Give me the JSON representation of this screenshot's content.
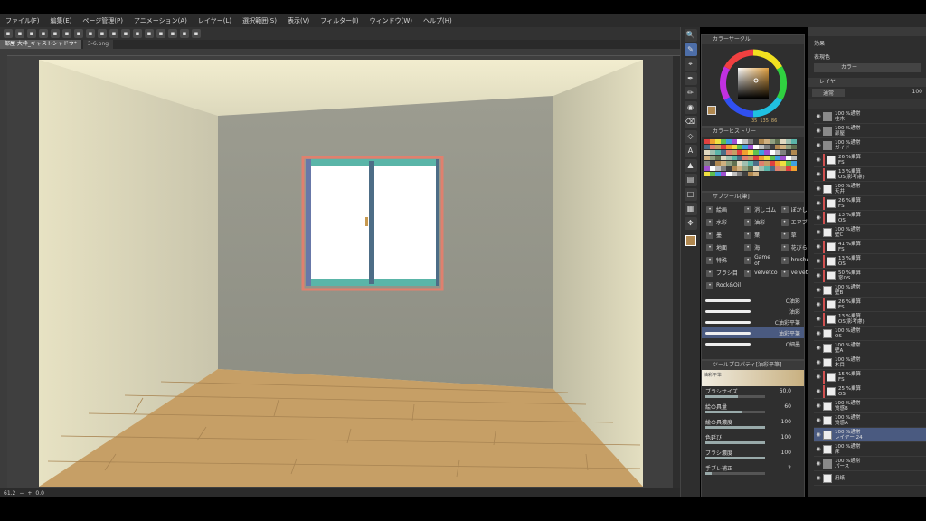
{
  "menu": [
    "ファイル(F)",
    "編集(E)",
    "ページ管理(P)",
    "アニメーション(A)",
    "レイヤー(L)",
    "選択範囲(S)",
    "表示(V)",
    "フィルター(I)",
    "ウィンドウ(W)",
    "ヘルプ(H)"
  ],
  "toolbar_icons": [
    "app-icon",
    "new-icon",
    "open-icon",
    "save-icon",
    "undo-icon",
    "redo-icon",
    "clear-icon",
    "transform-icon",
    "fill-icon",
    "deselect-icon",
    "invert-icon",
    "draw-border-icon",
    "snap-icon",
    "ruler-icon",
    "grid-icon",
    "guide-icon",
    "settings-icon"
  ],
  "doc_tabs": [
    {
      "label": "部屋 大枠_キャストシャドウ*"
    },
    {
      "label": "3-6.png"
    }
  ],
  "status": {
    "zoom": "61.2",
    "angle": "0.0"
  },
  "color": {
    "header": "カラーサークル",
    "main_color": "#b08850",
    "h": "35",
    "s": "135",
    "v": "86"
  },
  "history": {
    "header": "カラーヒストリー"
  },
  "subtool": {
    "header": "サブツール[筆]",
    "groups": [
      {
        "icon": "brush-icon",
        "label": "絵画"
      },
      {
        "icon": "eraser-icon",
        "label": "消しゴム"
      },
      {
        "icon": "blur-icon",
        "label": "ぼかし"
      },
      {
        "icon": "water-icon",
        "label": "水彩"
      },
      {
        "icon": "thick-icon",
        "label": "油彩"
      },
      {
        "icon": "air-icon",
        "label": "エアブラ"
      },
      {
        "icon": "ink-icon",
        "label": "墨"
      },
      {
        "icon": "leaf-icon",
        "label": "葉"
      },
      {
        "icon": "grass-icon",
        "label": "草"
      },
      {
        "icon": "ground-icon",
        "label": "地面"
      },
      {
        "icon": "sea-icon",
        "label": "海"
      },
      {
        "icon": "flower-icon",
        "label": "花びら"
      },
      {
        "icon": "special-icon",
        "label": "特殊"
      },
      {
        "icon": "game-icon",
        "label": "Game of"
      },
      {
        "icon": "brushes-icon",
        "label": "brushes"
      },
      {
        "icon": "brush2-icon",
        "label": "ブラシ目"
      },
      {
        "icon": "velvet-icon",
        "label": "velvetco"
      },
      {
        "icon": "velvet2-icon",
        "label": "velvetco"
      },
      {
        "icon": "rock-icon",
        "label": "Rock&Oil"
      }
    ],
    "brushes": [
      {
        "label": "C油彩"
      },
      {
        "label": "油彩"
      },
      {
        "label": "C油彩平筆"
      },
      {
        "label": "油彩平筆"
      },
      {
        "label": "C細墨"
      }
    ]
  },
  "tool_property": {
    "header": "ツールプロパティ[油彩平筆]",
    "preview_label": "油彩平筆",
    "rows": [
      {
        "label": "ブラシサイズ",
        "value": "60.0",
        "pct": 0.55
      },
      {
        "label": "絵の具量",
        "value": "60",
        "pct": 0.6
      },
      {
        "label": "絵の具濃度",
        "value": "100",
        "pct": 1.0
      },
      {
        "label": "色延び",
        "value": "100",
        "pct": 1.0
      },
      {
        "label": "ブラシ濃度",
        "value": "100",
        "pct": 1.0
      },
      {
        "label": "手ブレ補正",
        "value": "2",
        "pct": 0.1
      }
    ]
  },
  "right_panel": {
    "effect_label": "効果",
    "expression_label": "表現色",
    "expression_value": "カラー",
    "layer_header": "レイヤー",
    "blend_mode": "通常",
    "opacity": "100"
  },
  "layers": [
    {
      "t": "100 %通常\n柱木",
      "sel": false,
      "folder": true
    },
    {
      "t": "100 %通常\n部屋",
      "sel": false,
      "folder": true
    },
    {
      "t": "100 %通常\nガイド",
      "sel": false,
      "folder": true
    },
    {
      "t": "26 %乗算\nFS",
      "sel": false,
      "folder": false
    },
    {
      "t": "13 %乗算\nOS(影考慮)",
      "sel": false,
      "folder": false
    },
    {
      "t": "100 %通常\n天井",
      "sel": false,
      "folder": false
    },
    {
      "t": "26 %乗算\nFS",
      "sel": false,
      "folder": false
    },
    {
      "t": "13 %乗算\nOS",
      "sel": false,
      "folder": false
    },
    {
      "t": "100 %通常\n壁C",
      "sel": false,
      "folder": false
    },
    {
      "t": "41 %乗算\nFS",
      "sel": false,
      "folder": false
    },
    {
      "t": "13 %乗算\nOS",
      "sel": false,
      "folder": false
    },
    {
      "t": "50 %乗算\n窓OS",
      "sel": false,
      "folder": false
    },
    {
      "t": "100 %通常\n壁B",
      "sel": false,
      "folder": false
    },
    {
      "t": "26 %乗算\nFS",
      "sel": false,
      "folder": false
    },
    {
      "t": "13 %乗算\nOS(影考慮)",
      "sel": false,
      "folder": false
    },
    {
      "t": "100 %通常\nOS",
      "sel": false,
      "folder": false
    },
    {
      "t": "100 %通常\n壁A",
      "sel": false,
      "folder": false
    },
    {
      "t": "100 %通常\n木目",
      "sel": false,
      "folder": false
    },
    {
      "t": "15 %乗算\nFS",
      "sel": false,
      "folder": false
    },
    {
      "t": "25 %乗算\nOS",
      "sel": false,
      "folder": false
    },
    {
      "t": "100 %通常\n質感B",
      "sel": false,
      "folder": false
    },
    {
      "t": "100 %通常\n質感A",
      "sel": false,
      "folder": false
    },
    {
      "t": "100 %通常\nレイヤー 24",
      "sel": true,
      "folder": false
    },
    {
      "t": "100 %通常\n床",
      "sel": false,
      "folder": false
    },
    {
      "t": "100 %通常\nパース",
      "sel": false,
      "folder": true
    },
    {
      "t": "用紙",
      "sel": false,
      "folder": false
    }
  ]
}
